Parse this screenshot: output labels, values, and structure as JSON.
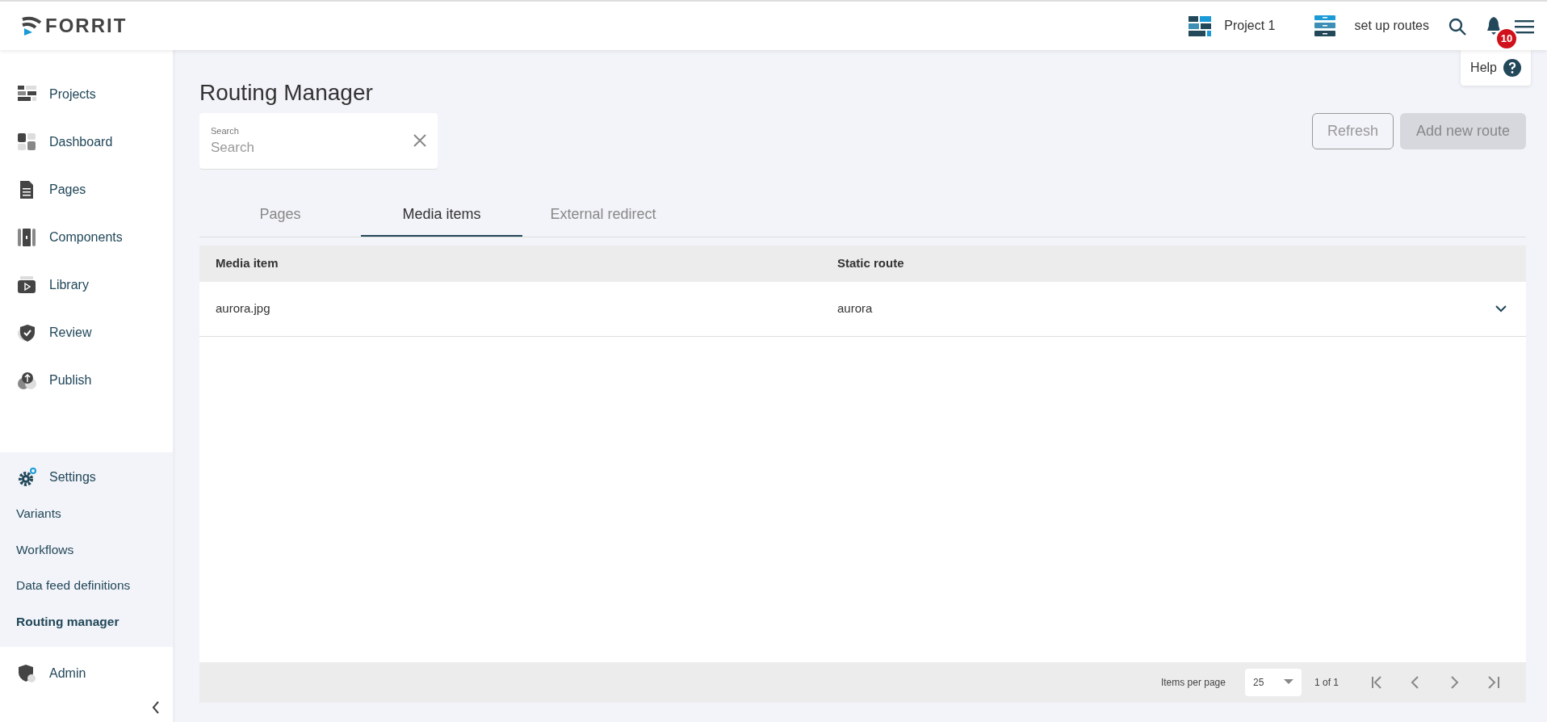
{
  "header": {
    "logo": "FORRIT",
    "project": "Project 1",
    "task": "set up routes",
    "notification_count": "10",
    "help": "Help"
  },
  "sidebar": {
    "items": [
      {
        "label": "Projects"
      },
      {
        "label": "Dashboard"
      },
      {
        "label": "Pages"
      },
      {
        "label": "Components"
      },
      {
        "label": "Library"
      },
      {
        "label": "Review"
      },
      {
        "label": "Publish"
      }
    ],
    "settings": {
      "label": "Settings",
      "items": [
        {
          "label": "Variants",
          "selected": false
        },
        {
          "label": "Workflows",
          "selected": false
        },
        {
          "label": "Data feed definitions",
          "selected": false
        },
        {
          "label": "Routing manager",
          "selected": true
        }
      ]
    },
    "admin": "Admin"
  },
  "page": {
    "title": "Routing Manager",
    "search": {
      "label": "Search",
      "placeholder": "Search"
    },
    "buttons": [
      {
        "label": "Refresh",
        "disabled": true
      },
      {
        "label": "Add new route",
        "disabled": true
      }
    ],
    "tabs": [
      {
        "label": "Pages",
        "selected": false
      },
      {
        "label": "Media items",
        "selected": true
      },
      {
        "label": "External redirect",
        "selected": false
      }
    ],
    "table": {
      "columns": [
        "Media item",
        "Static route"
      ],
      "rows": [
        {
          "cells": [
            "aurora.jpg",
            "aurora"
          ],
          "expanded": false
        }
      ]
    },
    "pagination": {
      "label": "Items per page",
      "per_page": "25",
      "page_info": "1 of 1"
    }
  }
}
